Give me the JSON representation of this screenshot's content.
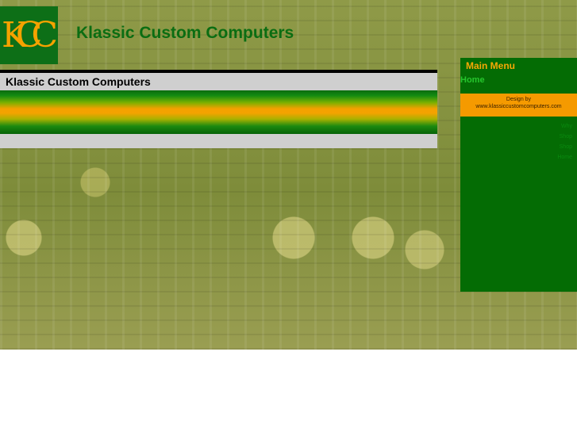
{
  "site": {
    "logo_text": "KCC",
    "title": "Klassic Custom Computers"
  },
  "content": {
    "heading": "Klassic Custom Computers"
  },
  "sidebar": {
    "menu_title": "Main Menu",
    "home_link": "Home",
    "design_by_label": "Design by",
    "design_by_url": "www.klassiccustomcomputers.com",
    "small_links": [
      "Why",
      "Shop",
      "Shop",
      "Home"
    ]
  },
  "colors": {
    "brand_green": "#0b6d12",
    "brand_orange": "#f59a00"
  }
}
